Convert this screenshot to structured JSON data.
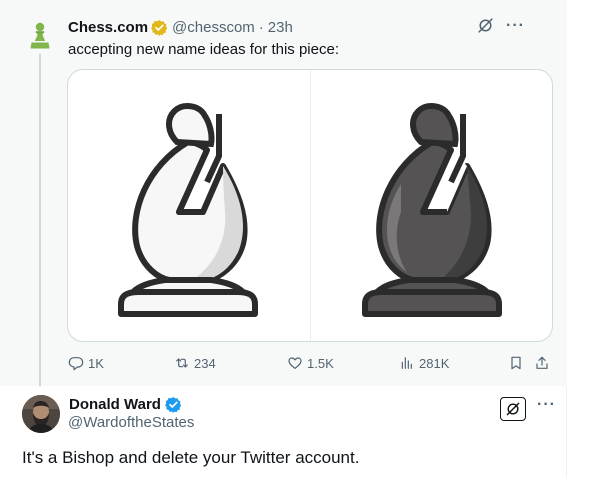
{
  "top_tweet": {
    "author_name": "Chess.com",
    "author_handle": "@chesscom",
    "separator": "·",
    "time": "23h",
    "text": "accepting new name ideas for this piece:",
    "verified_color": "#e2b719",
    "stats": {
      "replies": "1K",
      "reposts": "234",
      "likes": "1.5K",
      "views": "281K"
    }
  },
  "reply_tweet": {
    "author_name": "Donald Ward",
    "author_handle": "@WardoftheStates",
    "verified_color": "#1d9bf0",
    "text": "It's a Bishop and delete your Twitter account."
  },
  "icons": {
    "avatar_top": "pawn-logo-icon",
    "grok": "grok-icon",
    "more": "more-icon",
    "reply": "reply-icon",
    "repost": "repost-icon",
    "like": "like-icon",
    "views": "views-icon",
    "bookmark": "bookmark-icon",
    "share": "share-icon"
  },
  "colors": {
    "muted_text": "#536471",
    "pawn_green": "#81b64c",
    "panel_bg": "#f7f9f9"
  }
}
